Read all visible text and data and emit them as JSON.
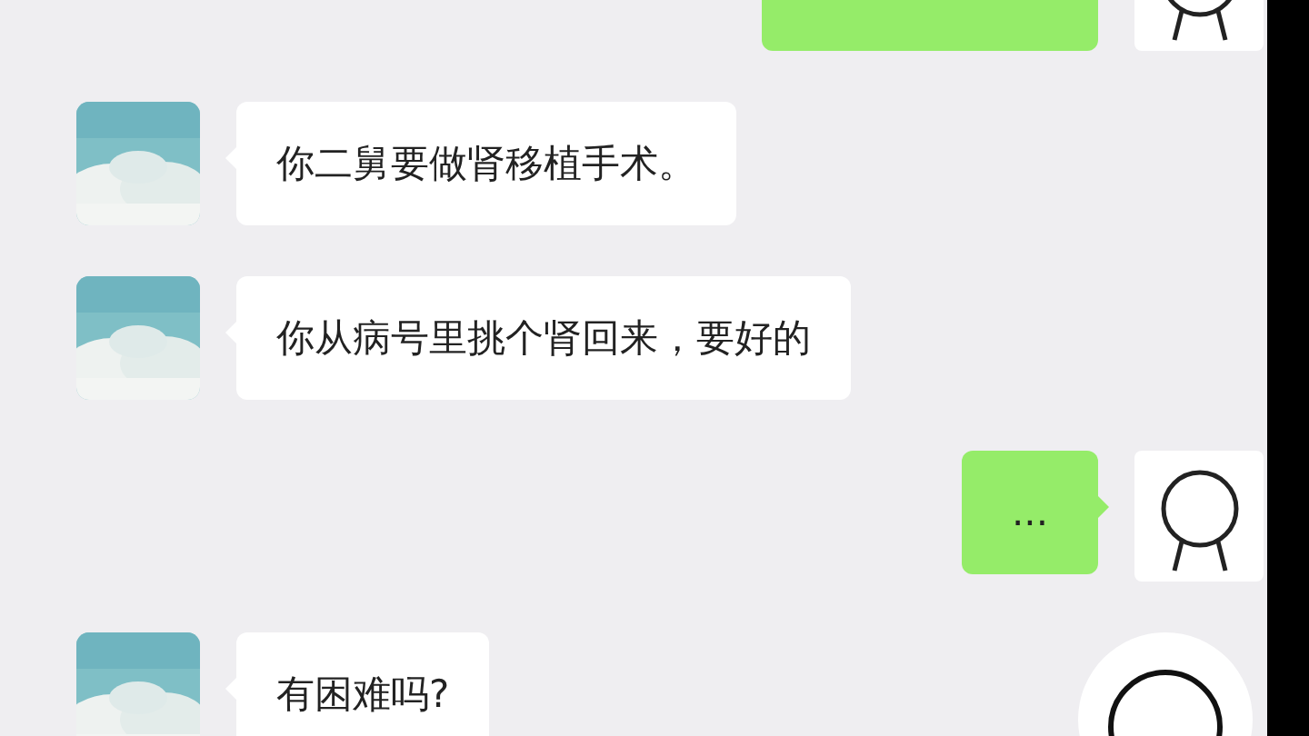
{
  "messages": [
    {
      "kind": "outgoing",
      "cut": true
    },
    {
      "kind": "incoming",
      "text": "你二舅要做肾移植手术。"
    },
    {
      "kind": "incoming",
      "text": "你从病号里挑个肾回来，要好的"
    },
    {
      "kind": "outgoing",
      "text": "..."
    },
    {
      "kind": "incoming",
      "text": "有困难吗?",
      "sticker": true
    }
  ]
}
